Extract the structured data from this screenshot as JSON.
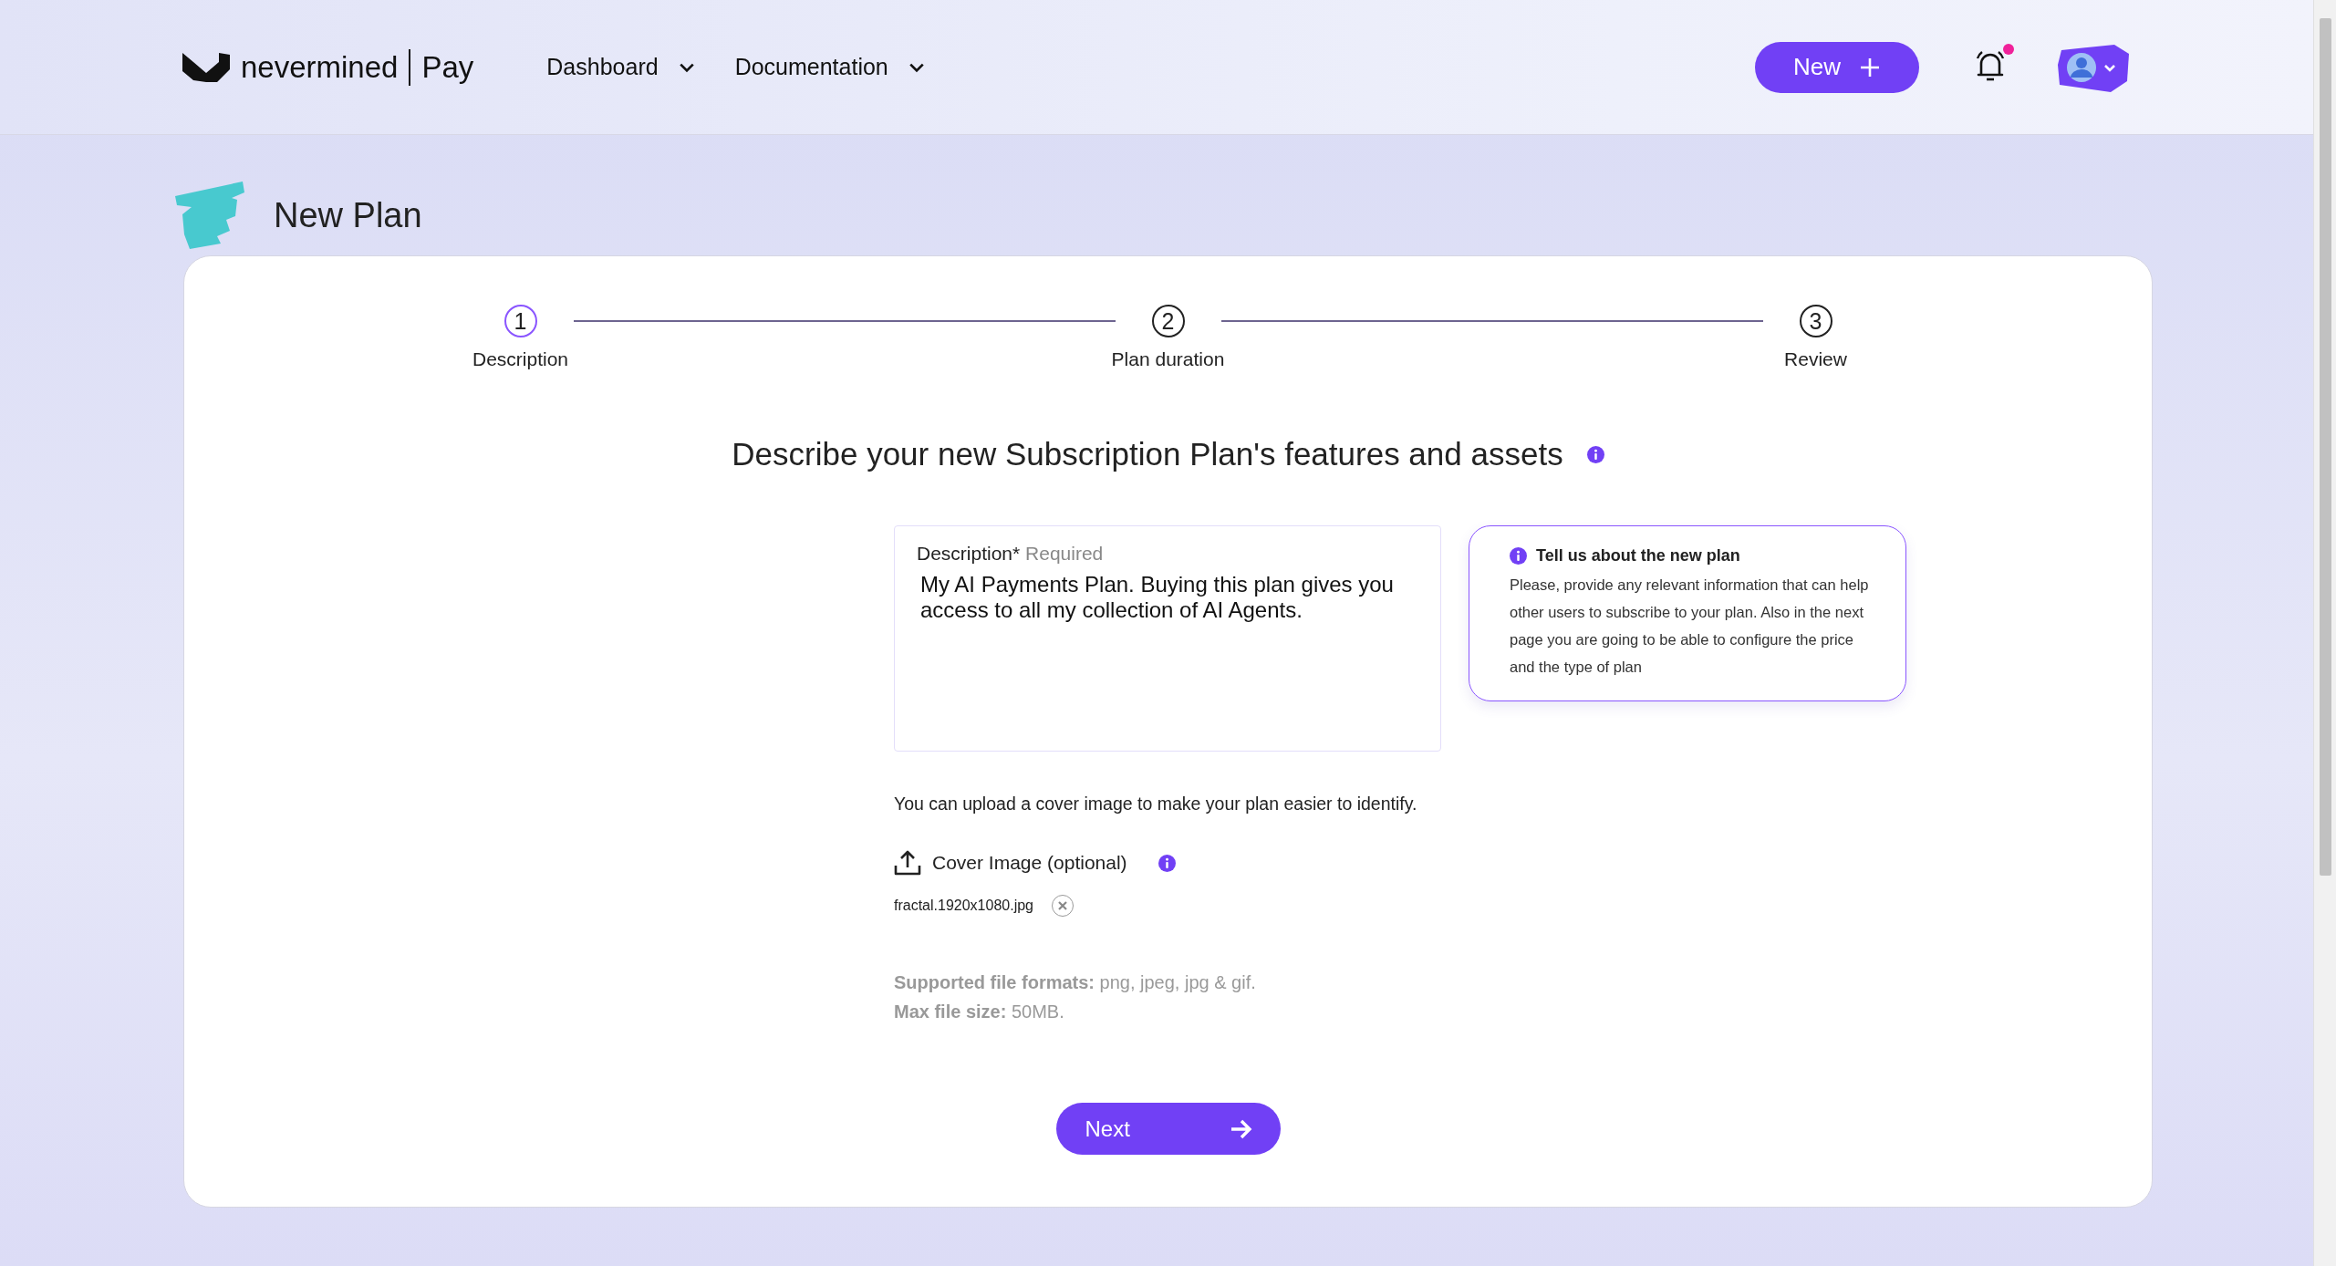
{
  "header": {
    "brand": {
      "name": "nevermined",
      "product": "Pay"
    },
    "nav": [
      {
        "label": "Dashboard"
      },
      {
        "label": "Documentation"
      }
    ],
    "new_button": "New",
    "notifications": {
      "unread": true
    }
  },
  "page_title": "New Plan",
  "stepper": [
    {
      "number": "1",
      "label": "Description",
      "selected": true
    },
    {
      "number": "2",
      "label": "Plan duration",
      "selected": false
    },
    {
      "number": "3",
      "label": "Review",
      "selected": false
    }
  ],
  "heading": "Describe your new Subscription Plan's features and assets",
  "description_field": {
    "label": "Description",
    "required_mark": "*",
    "hint": "Required",
    "value": "My AI Payments Plan. Buying this plan gives you access to all my collection of AI Agents."
  },
  "tip": {
    "title": "Tell us about the new plan",
    "body": "Please, provide any relevant information that can help other users to subscribe to your plan. Also in the next page you are going to be able to configure the price and the type of plan"
  },
  "upload_note": "You can upload a cover image to make your plan easier to identify.",
  "cover_image": {
    "label": "Cover Image (optional)",
    "file": "fractal.1920x1080.jpg"
  },
  "constraints": [
    "**Supported file formats:** png, jpeg, jpg & gif.",
    "**Max file size:** 50MB."
  ],
  "next_button": "Next"
}
